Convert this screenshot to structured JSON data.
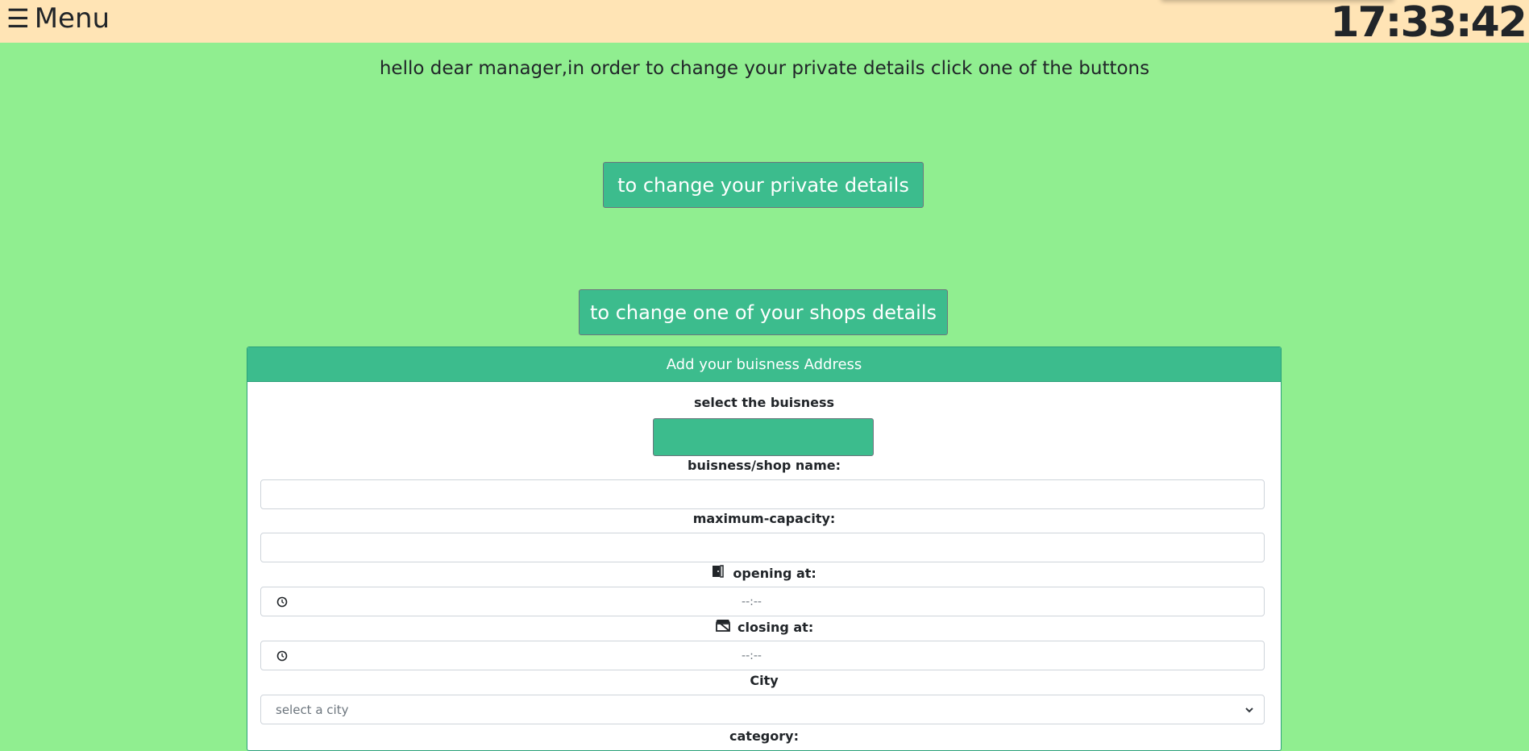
{
  "topbar": {
    "menu_icon": "☰",
    "menu_label": "Menu",
    "clock": "17:33:42",
    "background": "#ffe4b5"
  },
  "intro_text": "hello dear manager,in order to change your private details click one of the buttons",
  "buttons": {
    "private_details": "to change your private details",
    "shops_details": "to change one of your shops details"
  },
  "form": {
    "header": "Add your buisness Address",
    "select_business_label": "select the buisness",
    "business_name_label": "buisness/shop name:",
    "business_name_value": "",
    "max_capacity_label": "maximum-capacity:",
    "max_capacity_value": "",
    "opening_label": "opening at:",
    "opening_icon": "door-icon",
    "opening_value": "--:--",
    "closing_label": "closing at:",
    "closing_icon": "closed-shop-icon",
    "closing_value": "--:--",
    "city_label": "City",
    "city_placeholder": "select a city",
    "category_label": "category:"
  },
  "colors": {
    "page_bg": "#90ee90",
    "accent": "#3cbc8d",
    "text": "#212529"
  }
}
